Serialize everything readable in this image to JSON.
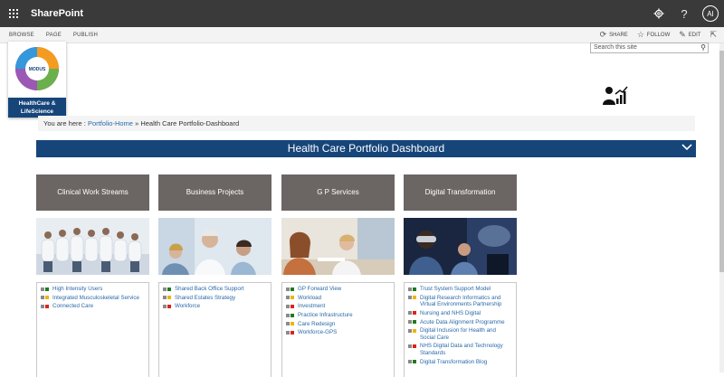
{
  "suite": {
    "brand": "SharePoint",
    "avatar_initials": "AI",
    "settings_icon": "gear-icon",
    "help_icon": "question-icon"
  },
  "ribbon": {
    "tabs": [
      "BROWSE",
      "PAGE",
      "PUBLISH"
    ],
    "share_label": "SHARE",
    "follow_label": "FOLLOW",
    "edit_label": "EDIT"
  },
  "search": {
    "placeholder": "Search this site"
  },
  "logo": {
    "caption": "HealthCare & LifeScience",
    "modus": "MODUS"
  },
  "breadcrumb": {
    "prefix": "You are here :",
    "home": "Portfolio-Home",
    "sep": "»",
    "current": "Health Care Portfolio-Dashboard"
  },
  "banner": {
    "title": "Health Care Portfolio Dashboard"
  },
  "status_colors": {
    "green": "#1f7a1f",
    "amber": "#f0b400",
    "red": "#d9241c",
    "accent": "#16457a"
  },
  "columns": [
    {
      "title": "Clinical Work Streams",
      "items": [
        {
          "label": "High Intensity Users",
          "status": "green"
        },
        {
          "label": "Integrated Musculoskeletal Service",
          "status": "amber"
        },
        {
          "label": "Connected Care",
          "status": "red"
        }
      ]
    },
    {
      "title": "Business Projects",
      "items": [
        {
          "label": "Shared Back Office Support",
          "status": "green"
        },
        {
          "label": "Shared Estates Strategy",
          "status": "amber"
        },
        {
          "label": "Workforce",
          "status": "red"
        }
      ]
    },
    {
      "title": "G P Services",
      "items": [
        {
          "label": "GP Forward View",
          "status": "green"
        },
        {
          "label": "Workload",
          "status": "amber"
        },
        {
          "label": "Investment",
          "status": "red"
        },
        {
          "label": "Practice Infrastructure",
          "status": "green"
        },
        {
          "label": "Care Redesign",
          "status": "amber"
        },
        {
          "label": "Workforce-GPS",
          "status": "red"
        }
      ]
    },
    {
      "title": "Digital Transformation",
      "items": [
        {
          "label": "Trust System Support Model",
          "status": "green"
        },
        {
          "label": "Digital Research Informatics and Virtual Environments Partnership",
          "status": "amber"
        },
        {
          "label": "Nursing and NHS Digital",
          "status": "red"
        },
        {
          "label": "Acute Data Alignment Programme",
          "status": "green"
        },
        {
          "label": "Digital Inclusion for Health and Social Care",
          "status": "amber"
        },
        {
          "label": "NHS Digital Data and Technology Standards",
          "status": "red"
        },
        {
          "label": "Digital Transformation Blog",
          "status": "green"
        }
      ]
    }
  ]
}
